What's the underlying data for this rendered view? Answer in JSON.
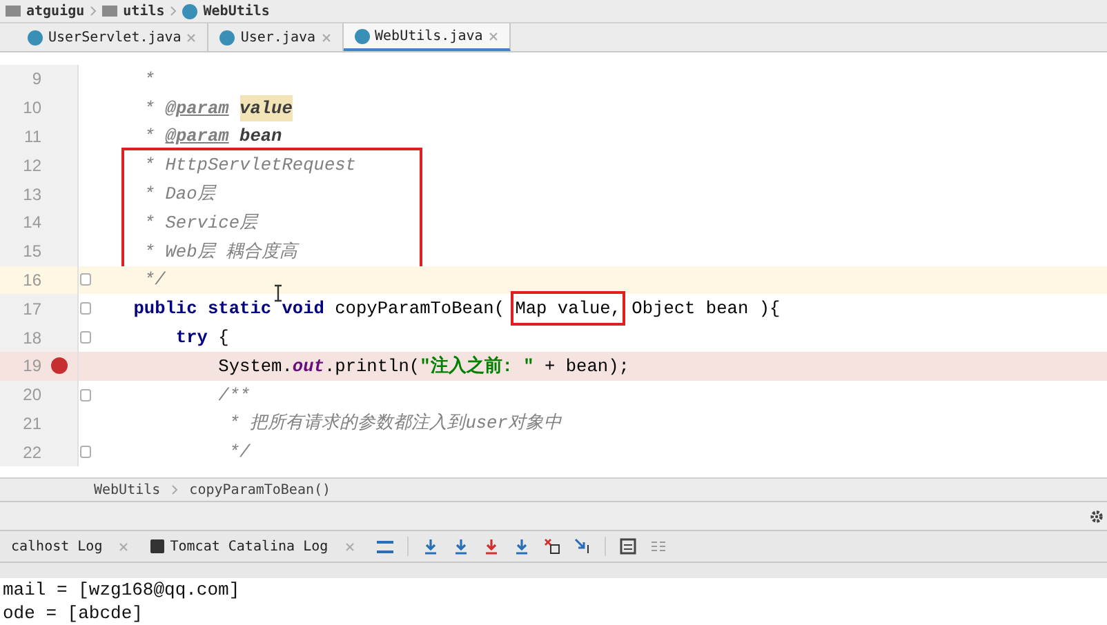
{
  "breadcrumb": [
    {
      "label": "atguigu",
      "kind": "folder"
    },
    {
      "label": "utils",
      "kind": "folder"
    },
    {
      "label": "WebUtils",
      "kind": "class"
    }
  ],
  "tabs": [
    {
      "label": "UserServlet.java",
      "selected": false
    },
    {
      "label": "User.java",
      "selected": false
    },
    {
      "label": "WebUtils.java",
      "selected": true
    }
  ],
  "editor": {
    "lines": [
      {
        "number": "9",
        "fold": false,
        "current": false,
        "breakpoint": false,
        "framed": false,
        "tokens": [
          {
            "text": "     *",
            "kind": "doc"
          }
        ]
      },
      {
        "number": "10",
        "fold": false,
        "current": false,
        "breakpoint": false,
        "framed": false,
        "tokens": [
          {
            "text": "     * ",
            "kind": "doc"
          },
          {
            "text": "@param",
            "kind": "doctag"
          },
          {
            "text": "value",
            "kind": "docparam",
            "highlighted": true
          }
        ]
      },
      {
        "number": "11",
        "fold": false,
        "current": false,
        "breakpoint": false,
        "framed": false,
        "tokens": [
          {
            "text": "     * ",
            "kind": "doc"
          },
          {
            "text": "@param",
            "kind": "doctag"
          },
          {
            "text": "bean",
            "kind": "docparam",
            "highlighted": false
          }
        ]
      },
      {
        "number": "12",
        "fold": false,
        "current": false,
        "breakpoint": false,
        "framed": true,
        "tokens": [
          {
            "text": "     * HttpServletRequest",
            "kind": "doc"
          }
        ]
      },
      {
        "number": "13",
        "fold": false,
        "current": false,
        "breakpoint": false,
        "framed": true,
        "tokens": [
          {
            "text": "     * Dao层",
            "kind": "doc"
          }
        ]
      },
      {
        "number": "14",
        "fold": false,
        "current": false,
        "breakpoint": false,
        "framed": true,
        "tokens": [
          {
            "text": "     * Service层",
            "kind": "doc"
          }
        ]
      },
      {
        "number": "15",
        "fold": false,
        "current": false,
        "breakpoint": false,
        "framed": true,
        "tokens": [
          {
            "text": "     * Web层 耦合度高",
            "kind": "doc"
          }
        ]
      },
      {
        "number": "16",
        "fold": true,
        "current": true,
        "breakpoint": false,
        "framed": false,
        "tokens": [
          {
            "text": "     */",
            "kind": "doc"
          }
        ]
      },
      {
        "number": "17",
        "fold": true,
        "current": false,
        "breakpoint": false,
        "framed": false,
        "tokens": [
          {
            "text": "    public static void",
            "kind": "keyword"
          },
          {
            "text": " copyParamToBean( ",
            "kind": "plain"
          },
          {
            "text": "Map value,",
            "kind": "plain",
            "boxed": true
          },
          {
            "text": " Object bean ){",
            "kind": "plain"
          }
        ]
      },
      {
        "number": "18",
        "fold": true,
        "current": false,
        "breakpoint": false,
        "framed": false,
        "tokens": [
          {
            "text": "        try",
            "kind": "keyword"
          },
          {
            "text": " {",
            "kind": "plain"
          }
        ]
      },
      {
        "number": "19",
        "fold": false,
        "current": false,
        "breakpoint": true,
        "framed": false,
        "tokens": [
          {
            "text": "            System.",
            "kind": "plain"
          },
          {
            "text": "out",
            "kind": "static"
          },
          {
            "text": ".println(",
            "kind": "plain"
          },
          {
            "text": "\"注入之前: \"",
            "kind": "string"
          },
          {
            "text": " + bean);",
            "kind": "plain"
          }
        ]
      },
      {
        "number": "20",
        "fold": true,
        "current": false,
        "breakpoint": false,
        "framed": false,
        "tokens": [
          {
            "text": "            /**",
            "kind": "doc"
          }
        ]
      },
      {
        "number": "21",
        "fold": false,
        "current": false,
        "breakpoint": false,
        "framed": false,
        "tokens": [
          {
            "text": "             * 把所有请求的参数都注入到user对象中",
            "kind": "doc"
          }
        ]
      },
      {
        "number": "22",
        "fold": true,
        "current": false,
        "breakpoint": false,
        "framed": false,
        "tokens": [
          {
            "text": "             */",
            "kind": "doc"
          }
        ]
      }
    ],
    "path": [
      "WebUtils",
      "copyParamToBean()"
    ]
  },
  "tool_tabs": [
    {
      "label": "calhost Log",
      "icon": false
    },
    {
      "label": "Tomcat Catalina Log",
      "icon": true
    }
  ],
  "console": [
    "mail = [wzg168@qq.com]",
    "ode = [abcde]"
  ]
}
